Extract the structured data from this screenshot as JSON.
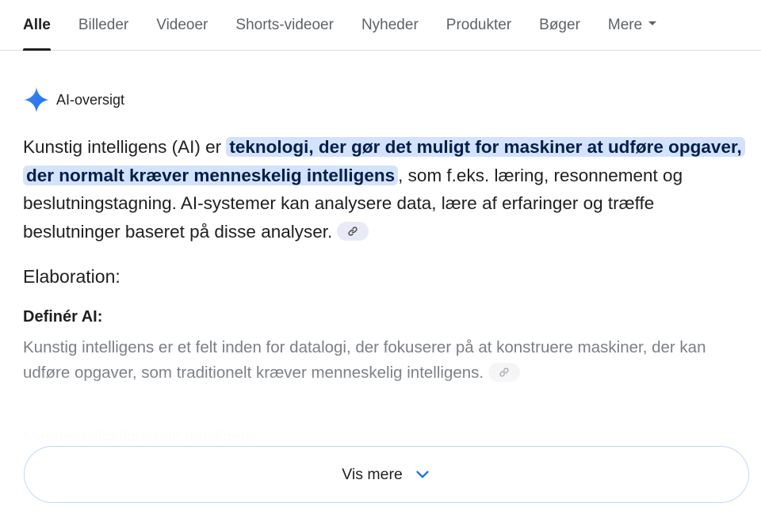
{
  "tabs": [
    {
      "label": "Alle",
      "active": true
    },
    {
      "label": "Billeder",
      "active": false
    },
    {
      "label": "Videoer",
      "active": false
    },
    {
      "label": "Shorts-videoer",
      "active": false
    },
    {
      "label": "Nyheder",
      "active": false
    },
    {
      "label": "Produkter",
      "active": false
    },
    {
      "label": "Bøger",
      "active": false
    },
    {
      "label": "Mere",
      "active": false,
      "has_dropdown": true
    }
  ],
  "ai_overview": {
    "title": "AI-oversigt",
    "icon": "sparkle-icon",
    "summary_prefix": "Kunstig intelligens (AI) er ",
    "summary_highlight": "teknologi, der gør det muligt for maskiner at udføre opgaver, der normalt kræver menneskelig intelligens",
    "summary_suffix": ", som f.eks. læring, resonnement og beslutningstagning. AI-systemer kan analysere data, lære af erfaringer og træffe beslutninger baseret på disse analyser.",
    "link_icon": "link-icon"
  },
  "elaboration": {
    "heading": "Elaboration:",
    "section_title": "Definér AI:",
    "section_text": "Kunstig intelligens er et felt inden for datalogi, der fokuserer på at konstruere maskiner, der kan udføre opgaver, som traditionelt kræver menneskelig intelligens.",
    "next_section_title": "Menneskelig-lignende intelligens:"
  },
  "show_more": {
    "label": "Vis mere",
    "icon": "chevron-down-icon"
  },
  "colors": {
    "highlight_bg": "#d3e3fd",
    "accent_blue": "#1a73e8",
    "border_blue": "#c2d7fc",
    "muted_text": "#7b7f85"
  }
}
